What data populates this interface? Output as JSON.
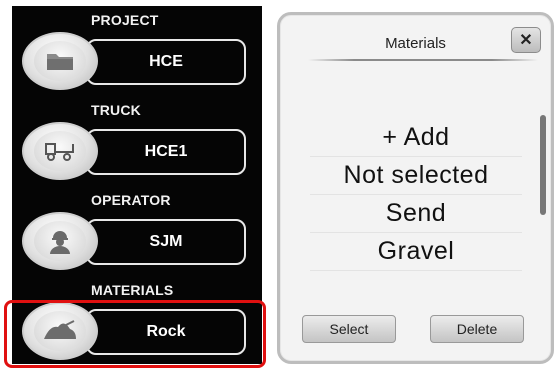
{
  "left": {
    "sections": [
      {
        "label": "PROJECT",
        "value": "HCE",
        "icon": "folder-icon"
      },
      {
        "label": "TRUCK",
        "value": "HCE1",
        "icon": "truck-icon"
      },
      {
        "label": "OPERATOR",
        "value": "SJM",
        "icon": "operator-icon"
      },
      {
        "label": "MATERIALS",
        "value": "Rock",
        "icon": "rock-pile-icon"
      }
    ],
    "selected_color": "#e01010"
  },
  "dialog": {
    "title": "Materials",
    "close_glyph": "✕",
    "items": [
      "+ Add",
      "Not selected",
      "Send",
      "Gravel"
    ],
    "select_label": "Select",
    "delete_label": "Delete"
  }
}
